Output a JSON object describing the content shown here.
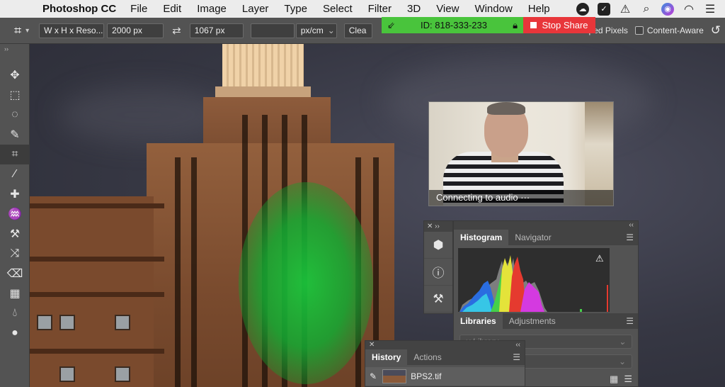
{
  "menubar": {
    "app_name": "Photoshop CC",
    "items": [
      "File",
      "Edit",
      "Image",
      "Layer",
      "Type",
      "Select",
      "Filter",
      "3D",
      "View",
      "Window",
      "Help"
    ]
  },
  "share_banner": {
    "id_text": "ID: 818-333-233",
    "stop_label": "Stop Share",
    "green": "#49c43c",
    "red": "#e8363a"
  },
  "options_bar": {
    "ratio_select": "W x H x Reso...",
    "width_value": "2000 px",
    "height_value": "1067 px",
    "resolution_value": "",
    "unit_select": "px/cm",
    "clear_label": "Clea",
    "delete_cropped_label": "ped Pixels",
    "content_aware_label": "Content-Aware"
  },
  "toolbar": {
    "tools": [
      "move-icon",
      "marquee-icon",
      "lasso-icon",
      "quick-select-icon",
      "crop-icon",
      "eyedropper-icon",
      "healing-icon",
      "brush-icon",
      "stamp-icon",
      "history-brush-icon",
      "eraser-icon",
      "gradient-icon",
      "blur-icon"
    ],
    "active_tool": "crop-icon"
  },
  "webcam": {
    "status": "Connecting to audio ···"
  },
  "histogram_panel": {
    "tabs": [
      "Histogram",
      "Navigator"
    ],
    "active_tab": "Histogram"
  },
  "libraries_panel": {
    "tabs": [
      "Libraries",
      "Adjustments"
    ],
    "active_tab": "Libraries",
    "library_placeholder": "y Library"
  },
  "history_panel": {
    "tabs": [
      "History",
      "Actions"
    ],
    "active_tab": "History",
    "items": [
      {
        "name": "BPS2.tif"
      }
    ]
  }
}
